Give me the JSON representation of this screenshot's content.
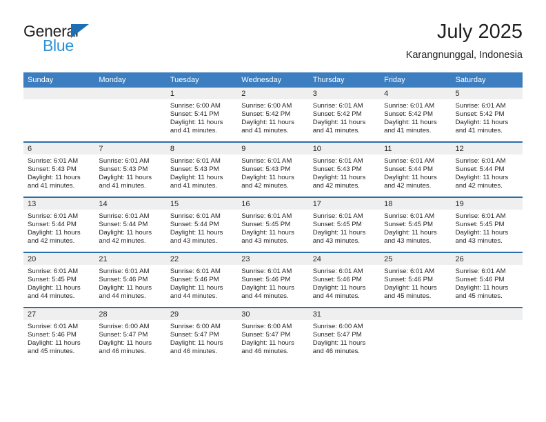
{
  "brand": {
    "name_part1": "General",
    "name_part2": "Blue",
    "accent_color": "#2b8fd6",
    "triangle_color": "#1c6fb5"
  },
  "header": {
    "title": "July 2025",
    "subtitle": "Karangnunggal, Indonesia"
  },
  "theme": {
    "header_row_bg": "#3c7ebf",
    "row_divider": "#2b6da8",
    "daynum_band_bg": "#efefef",
    "text_color": "#231f20"
  },
  "weekdays": [
    "Sunday",
    "Monday",
    "Tuesday",
    "Wednesday",
    "Thursday",
    "Friday",
    "Saturday"
  ],
  "weeks": [
    [
      {
        "day": "",
        "sunrise": "",
        "sunset": "",
        "daylight1": "",
        "daylight2": ""
      },
      {
        "day": "",
        "sunrise": "",
        "sunset": "",
        "daylight1": "",
        "daylight2": ""
      },
      {
        "day": "1",
        "sunrise": "Sunrise: 6:00 AM",
        "sunset": "Sunset: 5:41 PM",
        "daylight1": "Daylight: 11 hours",
        "daylight2": "and 41 minutes."
      },
      {
        "day": "2",
        "sunrise": "Sunrise: 6:00 AM",
        "sunset": "Sunset: 5:42 PM",
        "daylight1": "Daylight: 11 hours",
        "daylight2": "and 41 minutes."
      },
      {
        "day": "3",
        "sunrise": "Sunrise: 6:01 AM",
        "sunset": "Sunset: 5:42 PM",
        "daylight1": "Daylight: 11 hours",
        "daylight2": "and 41 minutes."
      },
      {
        "day": "4",
        "sunrise": "Sunrise: 6:01 AM",
        "sunset": "Sunset: 5:42 PM",
        "daylight1": "Daylight: 11 hours",
        "daylight2": "and 41 minutes."
      },
      {
        "day": "5",
        "sunrise": "Sunrise: 6:01 AM",
        "sunset": "Sunset: 5:42 PM",
        "daylight1": "Daylight: 11 hours",
        "daylight2": "and 41 minutes."
      }
    ],
    [
      {
        "day": "6",
        "sunrise": "Sunrise: 6:01 AM",
        "sunset": "Sunset: 5:43 PM",
        "daylight1": "Daylight: 11 hours",
        "daylight2": "and 41 minutes."
      },
      {
        "day": "7",
        "sunrise": "Sunrise: 6:01 AM",
        "sunset": "Sunset: 5:43 PM",
        "daylight1": "Daylight: 11 hours",
        "daylight2": "and 41 minutes."
      },
      {
        "day": "8",
        "sunrise": "Sunrise: 6:01 AM",
        "sunset": "Sunset: 5:43 PM",
        "daylight1": "Daylight: 11 hours",
        "daylight2": "and 41 minutes."
      },
      {
        "day": "9",
        "sunrise": "Sunrise: 6:01 AM",
        "sunset": "Sunset: 5:43 PM",
        "daylight1": "Daylight: 11 hours",
        "daylight2": "and 42 minutes."
      },
      {
        "day": "10",
        "sunrise": "Sunrise: 6:01 AM",
        "sunset": "Sunset: 5:43 PM",
        "daylight1": "Daylight: 11 hours",
        "daylight2": "and 42 minutes."
      },
      {
        "day": "11",
        "sunrise": "Sunrise: 6:01 AM",
        "sunset": "Sunset: 5:44 PM",
        "daylight1": "Daylight: 11 hours",
        "daylight2": "and 42 minutes."
      },
      {
        "day": "12",
        "sunrise": "Sunrise: 6:01 AM",
        "sunset": "Sunset: 5:44 PM",
        "daylight1": "Daylight: 11 hours",
        "daylight2": "and 42 minutes."
      }
    ],
    [
      {
        "day": "13",
        "sunrise": "Sunrise: 6:01 AM",
        "sunset": "Sunset: 5:44 PM",
        "daylight1": "Daylight: 11 hours",
        "daylight2": "and 42 minutes."
      },
      {
        "day": "14",
        "sunrise": "Sunrise: 6:01 AM",
        "sunset": "Sunset: 5:44 PM",
        "daylight1": "Daylight: 11 hours",
        "daylight2": "and 42 minutes."
      },
      {
        "day": "15",
        "sunrise": "Sunrise: 6:01 AM",
        "sunset": "Sunset: 5:44 PM",
        "daylight1": "Daylight: 11 hours",
        "daylight2": "and 43 minutes."
      },
      {
        "day": "16",
        "sunrise": "Sunrise: 6:01 AM",
        "sunset": "Sunset: 5:45 PM",
        "daylight1": "Daylight: 11 hours",
        "daylight2": "and 43 minutes."
      },
      {
        "day": "17",
        "sunrise": "Sunrise: 6:01 AM",
        "sunset": "Sunset: 5:45 PM",
        "daylight1": "Daylight: 11 hours",
        "daylight2": "and 43 minutes."
      },
      {
        "day": "18",
        "sunrise": "Sunrise: 6:01 AM",
        "sunset": "Sunset: 5:45 PM",
        "daylight1": "Daylight: 11 hours",
        "daylight2": "and 43 minutes."
      },
      {
        "day": "19",
        "sunrise": "Sunrise: 6:01 AM",
        "sunset": "Sunset: 5:45 PM",
        "daylight1": "Daylight: 11 hours",
        "daylight2": "and 43 minutes."
      }
    ],
    [
      {
        "day": "20",
        "sunrise": "Sunrise: 6:01 AM",
        "sunset": "Sunset: 5:45 PM",
        "daylight1": "Daylight: 11 hours",
        "daylight2": "and 44 minutes."
      },
      {
        "day": "21",
        "sunrise": "Sunrise: 6:01 AM",
        "sunset": "Sunset: 5:46 PM",
        "daylight1": "Daylight: 11 hours",
        "daylight2": "and 44 minutes."
      },
      {
        "day": "22",
        "sunrise": "Sunrise: 6:01 AM",
        "sunset": "Sunset: 5:46 PM",
        "daylight1": "Daylight: 11 hours",
        "daylight2": "and 44 minutes."
      },
      {
        "day": "23",
        "sunrise": "Sunrise: 6:01 AM",
        "sunset": "Sunset: 5:46 PM",
        "daylight1": "Daylight: 11 hours",
        "daylight2": "and 44 minutes."
      },
      {
        "day": "24",
        "sunrise": "Sunrise: 6:01 AM",
        "sunset": "Sunset: 5:46 PM",
        "daylight1": "Daylight: 11 hours",
        "daylight2": "and 44 minutes."
      },
      {
        "day": "25",
        "sunrise": "Sunrise: 6:01 AM",
        "sunset": "Sunset: 5:46 PM",
        "daylight1": "Daylight: 11 hours",
        "daylight2": "and 45 minutes."
      },
      {
        "day": "26",
        "sunrise": "Sunrise: 6:01 AM",
        "sunset": "Sunset: 5:46 PM",
        "daylight1": "Daylight: 11 hours",
        "daylight2": "and 45 minutes."
      }
    ],
    [
      {
        "day": "27",
        "sunrise": "Sunrise: 6:01 AM",
        "sunset": "Sunset: 5:46 PM",
        "daylight1": "Daylight: 11 hours",
        "daylight2": "and 45 minutes."
      },
      {
        "day": "28",
        "sunrise": "Sunrise: 6:00 AM",
        "sunset": "Sunset: 5:47 PM",
        "daylight1": "Daylight: 11 hours",
        "daylight2": "and 46 minutes."
      },
      {
        "day": "29",
        "sunrise": "Sunrise: 6:00 AM",
        "sunset": "Sunset: 5:47 PM",
        "daylight1": "Daylight: 11 hours",
        "daylight2": "and 46 minutes."
      },
      {
        "day": "30",
        "sunrise": "Sunrise: 6:00 AM",
        "sunset": "Sunset: 5:47 PM",
        "daylight1": "Daylight: 11 hours",
        "daylight2": "and 46 minutes."
      },
      {
        "day": "31",
        "sunrise": "Sunrise: 6:00 AM",
        "sunset": "Sunset: 5:47 PM",
        "daylight1": "Daylight: 11 hours",
        "daylight2": "and 46 minutes."
      },
      {
        "day": "",
        "sunrise": "",
        "sunset": "",
        "daylight1": "",
        "daylight2": ""
      },
      {
        "day": "",
        "sunrise": "",
        "sunset": "",
        "daylight1": "",
        "daylight2": ""
      }
    ]
  ]
}
